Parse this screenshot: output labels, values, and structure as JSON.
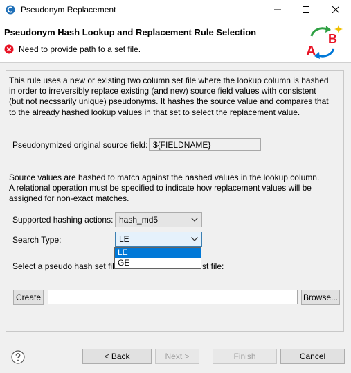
{
  "window": {
    "title": "Pseudonym Replacement"
  },
  "header": {
    "title": "Pseudonym Hash Lookup and Replacement Rule Selection",
    "error_message": "Need to provide path to a set file.",
    "graphic_letters": {
      "a": "A",
      "b": "B"
    }
  },
  "description": [
    "This rule uses a new or existing two column set file where the lookup column is hashed",
    "in order to irreversibly replace existing (and new) source field values with consistent",
    "(but not necssarily unique) pseudonyms. It hashes the source value and compares that",
    "to the already hashed lookup values in that set to select the replacement value."
  ],
  "source_field": {
    "label": "Pseudonymized original source field:",
    "value": "${FIELDNAME}"
  },
  "hash_note": [
    "Source values are hashed to match against the hashed values in the lookup column.",
    "A relational operation must be specified to indicate how replacement values will be",
    "assigned for non-exact matches."
  ],
  "hashing": {
    "label": "Supported hashing actions:",
    "selected": "hash_md5"
  },
  "search_type": {
    "label": "Search Type:",
    "selected": "LE",
    "options": [
      "LE",
      "GE"
    ]
  },
  "set_file": {
    "label_part1": "Select a pseudo hash set file",
    "label_part2": "st file:",
    "create_label": "Create",
    "browse_label": "Browse...",
    "value": ""
  },
  "footer": {
    "back_label": "< Back",
    "next_label": "Next >",
    "finish_label": "Finish",
    "cancel_label": "Cancel"
  },
  "colors": {
    "selection": "#0078d7",
    "error": "#e81123",
    "graphic_red": "#e81123",
    "graphic_green": "#2ea043",
    "graphic_blue": "#0078d7"
  },
  "icons": [
    "app-icon",
    "minimize-icon",
    "maximize-icon",
    "close-icon",
    "error-icon",
    "chevron-down-icon",
    "help-icon"
  ]
}
